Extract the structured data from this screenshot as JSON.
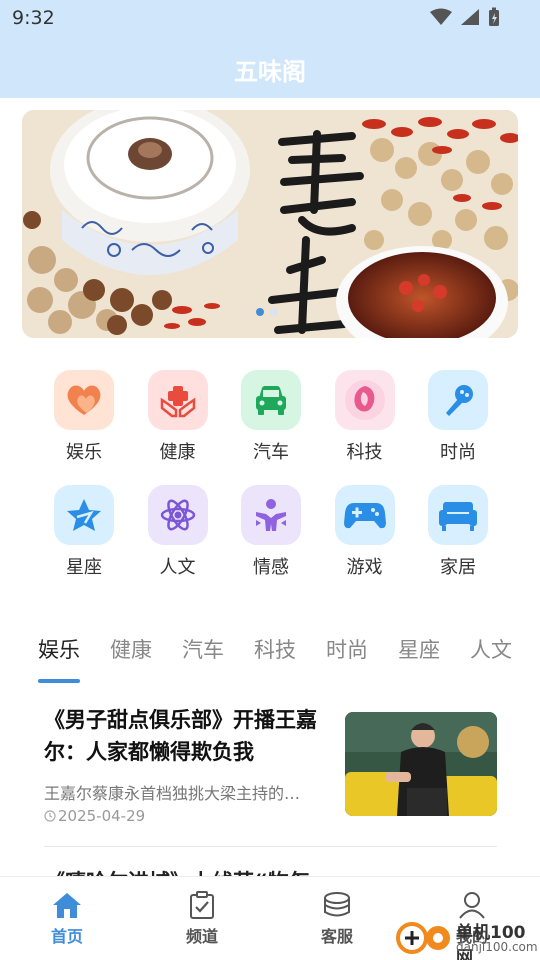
{
  "status": {
    "time": "9:32"
  },
  "app": {
    "title": "五味阁"
  },
  "banner": {
    "slides": 2,
    "active": 0
  },
  "categories": [
    {
      "label": "娱乐",
      "icon": "heart-icon",
      "color": "#ffe4d6"
    },
    {
      "label": "健康",
      "icon": "medical-hands-icon",
      "color": "#ffe0de"
    },
    {
      "label": "汽车",
      "icon": "car-icon",
      "color": "#d6f5e2"
    },
    {
      "label": "科技",
      "icon": "flower-icon",
      "color": "#fde3ec"
    },
    {
      "label": "时尚",
      "icon": "microphone-icon",
      "color": "#d8efff"
    },
    {
      "label": "星座",
      "icon": "star-icon",
      "color": "#d8efff"
    },
    {
      "label": "人文",
      "icon": "atom-icon",
      "color": "#ece4fb"
    },
    {
      "label": "情感",
      "icon": "person-icon",
      "color": "#ece4fb"
    },
    {
      "label": "游戏",
      "icon": "gamepad-icon",
      "color": "#d8efff"
    },
    {
      "label": "家居",
      "icon": "sofa-icon",
      "color": "#d8efff"
    }
  ],
  "tabs": [
    "娱乐",
    "健康",
    "汽车",
    "科技",
    "时尚",
    "星座",
    "人文"
  ],
  "active_tab": "娱乐",
  "article": {
    "title": "《男子甜点俱乐部》开播王嘉尔：人家都懒得欺负我",
    "summary": "王嘉尔蔡康永首档独挑大梁主持的…",
    "date": "2025-04-29"
  },
  "next_article_peek": "《嘻哈尔进城》上线萌“物怎",
  "bottom_nav": [
    {
      "label": "首页",
      "icon": "home-icon",
      "active": true
    },
    {
      "label": "频道",
      "icon": "clipboard-check-icon",
      "active": false
    },
    {
      "label": "客服",
      "icon": "coins-icon",
      "active": false
    },
    {
      "label": "我的",
      "icon": "user-icon",
      "active": false
    }
  ],
  "watermark": {
    "text": "单机100网",
    "sub": "danji100.com"
  },
  "colors": {
    "accent": "#3f8cd8",
    "header_bg": "#cfe6fb"
  }
}
